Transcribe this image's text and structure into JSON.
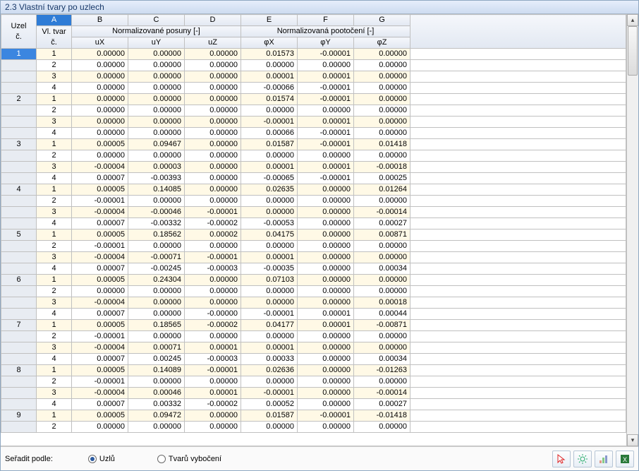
{
  "title": "2.3 Vlastní tvary po uzlech",
  "letters": [
    "A",
    "B",
    "C",
    "D",
    "E",
    "F",
    "G"
  ],
  "group1": {
    "a": "Vl. tvar",
    "posuny": "Normalizované posuny [-]",
    "poot": "Normalizovaná pootočení [-]"
  },
  "uzel_head": {
    "l1": "Uzel",
    "l2": "č."
  },
  "subs": {
    "a": "č.",
    "b": "uX",
    "c": "uY",
    "d": "uZ",
    "e": "φX",
    "f": "φY",
    "g": "φZ"
  },
  "sort": {
    "label": "Seřadit podle:",
    "opt1": "Uzlů",
    "opt2": "Tvarů vybočení"
  },
  "rows": [
    {
      "uzel": "1",
      "vt": "1",
      "ux": "0.00000",
      "uy": "0.00000",
      "uz": "0.00000",
      "px": "0.01573",
      "py": "-0.00001",
      "pz": "0.00000",
      "sh": true,
      "first": true
    },
    {
      "uzel": "",
      "vt": "2",
      "ux": "0.00000",
      "uy": "0.00000",
      "uz": "0.00000",
      "px": "0.00000",
      "py": "0.00000",
      "pz": "0.00000"
    },
    {
      "uzel": "",
      "vt": "3",
      "ux": "0.00000",
      "uy": "0.00000",
      "uz": "0.00000",
      "px": "0.00001",
      "py": "0.00001",
      "pz": "0.00000",
      "sh": true
    },
    {
      "uzel": "",
      "vt": "4",
      "ux": "0.00000",
      "uy": "0.00000",
      "uz": "0.00000",
      "px": "-0.00066",
      "py": "-0.00001",
      "pz": "0.00000"
    },
    {
      "uzel": "2",
      "vt": "1",
      "ux": "0.00000",
      "uy": "0.00000",
      "uz": "0.00000",
      "px": "0.01574",
      "py": "-0.00001",
      "pz": "0.00000",
      "sh": true
    },
    {
      "uzel": "",
      "vt": "2",
      "ux": "0.00000",
      "uy": "0.00000",
      "uz": "0.00000",
      "px": "0.00000",
      "py": "0.00000",
      "pz": "0.00000"
    },
    {
      "uzel": "",
      "vt": "3",
      "ux": "0.00000",
      "uy": "0.00000",
      "uz": "0.00000",
      "px": "-0.00001",
      "py": "0.00001",
      "pz": "0.00000",
      "sh": true
    },
    {
      "uzel": "",
      "vt": "4",
      "ux": "0.00000",
      "uy": "0.00000",
      "uz": "0.00000",
      "px": "0.00066",
      "py": "-0.00001",
      "pz": "0.00000"
    },
    {
      "uzel": "3",
      "vt": "1",
      "ux": "0.00005",
      "uy": "0.09467",
      "uz": "0.00000",
      "px": "0.01587",
      "py": "-0.00001",
      "pz": "0.01418",
      "sh": true
    },
    {
      "uzel": "",
      "vt": "2",
      "ux": "0.00000",
      "uy": "0.00000",
      "uz": "0.00000",
      "px": "0.00000",
      "py": "0.00000",
      "pz": "0.00000"
    },
    {
      "uzel": "",
      "vt": "3",
      "ux": "-0.00004",
      "uy": "0.00003",
      "uz": "0.00000",
      "px": "0.00001",
      "py": "0.00001",
      "pz": "-0.00018",
      "sh": true
    },
    {
      "uzel": "",
      "vt": "4",
      "ux": "0.00007",
      "uy": "-0.00393",
      "uz": "0.00000",
      "px": "-0.00065",
      "py": "-0.00001",
      "pz": "0.00025"
    },
    {
      "uzel": "4",
      "vt": "1",
      "ux": "0.00005",
      "uy": "0.14085",
      "uz": "0.00000",
      "px": "0.02635",
      "py": "0.00000",
      "pz": "0.01264",
      "sh": true
    },
    {
      "uzel": "",
      "vt": "2",
      "ux": "-0.00001",
      "uy": "0.00000",
      "uz": "0.00000",
      "px": "0.00000",
      "py": "0.00000",
      "pz": "0.00000"
    },
    {
      "uzel": "",
      "vt": "3",
      "ux": "-0.00004",
      "uy": "-0.00046",
      "uz": "-0.00001",
      "px": "0.00000",
      "py": "0.00000",
      "pz": "-0.00014",
      "sh": true
    },
    {
      "uzel": "",
      "vt": "4",
      "ux": "0.00007",
      "uy": "-0.00332",
      "uz": "-0.00002",
      "px": "-0.00053",
      "py": "0.00000",
      "pz": "0.00027"
    },
    {
      "uzel": "5",
      "vt": "1",
      "ux": "0.00005",
      "uy": "0.18562",
      "uz": "0.00002",
      "px": "0.04175",
      "py": "0.00000",
      "pz": "0.00871",
      "sh": true
    },
    {
      "uzel": "",
      "vt": "2",
      "ux": "-0.00001",
      "uy": "0.00000",
      "uz": "0.00000",
      "px": "0.00000",
      "py": "0.00000",
      "pz": "0.00000"
    },
    {
      "uzel": "",
      "vt": "3",
      "ux": "-0.00004",
      "uy": "-0.00071",
      "uz": "-0.00001",
      "px": "0.00001",
      "py": "0.00000",
      "pz": "0.00000",
      "sh": true
    },
    {
      "uzel": "",
      "vt": "4",
      "ux": "0.00007",
      "uy": "-0.00245",
      "uz": "-0.00003",
      "px": "-0.00035",
      "py": "0.00000",
      "pz": "0.00034"
    },
    {
      "uzel": "6",
      "vt": "1",
      "ux": "0.00005",
      "uy": "0.24304",
      "uz": "0.00000",
      "px": "0.07103",
      "py": "0.00000",
      "pz": "0.00000",
      "sh": true
    },
    {
      "uzel": "",
      "vt": "2",
      "ux": "0.00000",
      "uy": "0.00000",
      "uz": "0.00000",
      "px": "0.00000",
      "py": "0.00000",
      "pz": "0.00000"
    },
    {
      "uzel": "",
      "vt": "3",
      "ux": "-0.00004",
      "uy": "0.00000",
      "uz": "0.00000",
      "px": "0.00000",
      "py": "0.00000",
      "pz": "0.00018",
      "sh": true
    },
    {
      "uzel": "",
      "vt": "4",
      "ux": "0.00007",
      "uy": "0.00000",
      "uz": "-0.00000",
      "px": "-0.00001",
      "py": "0.00001",
      "pz": "0.00044"
    },
    {
      "uzel": "7",
      "vt": "1",
      "ux": "0.00005",
      "uy": "0.18565",
      "uz": "-0.00002",
      "px": "0.04177",
      "py": "0.00001",
      "pz": "-0.00871",
      "sh": true
    },
    {
      "uzel": "",
      "vt": "2",
      "ux": "-0.00001",
      "uy": "0.00000",
      "uz": "0.00000",
      "px": "0.00000",
      "py": "0.00000",
      "pz": "0.00000"
    },
    {
      "uzel": "",
      "vt": "3",
      "ux": "-0.00004",
      "uy": "0.00071",
      "uz": "0.00001",
      "px": "0.00001",
      "py": "0.00000",
      "pz": "0.00000",
      "sh": true
    },
    {
      "uzel": "",
      "vt": "4",
      "ux": "0.00007",
      "uy": "0.00245",
      "uz": "-0.00003",
      "px": "0.00033",
      "py": "0.00000",
      "pz": "0.00034"
    },
    {
      "uzel": "8",
      "vt": "1",
      "ux": "0.00005",
      "uy": "0.14089",
      "uz": "-0.00001",
      "px": "0.02636",
      "py": "0.00000",
      "pz": "-0.01263",
      "sh": true
    },
    {
      "uzel": "",
      "vt": "2",
      "ux": "-0.00001",
      "uy": "0.00000",
      "uz": "0.00000",
      "px": "0.00000",
      "py": "0.00000",
      "pz": "0.00000"
    },
    {
      "uzel": "",
      "vt": "3",
      "ux": "-0.00004",
      "uy": "0.00046",
      "uz": "0.00001",
      "px": "-0.00001",
      "py": "0.00000",
      "pz": "-0.00014",
      "sh": true
    },
    {
      "uzel": "",
      "vt": "4",
      "ux": "0.00007",
      "uy": "0.00332",
      "uz": "-0.00002",
      "px": "0.00052",
      "py": "0.00000",
      "pz": "0.00027"
    },
    {
      "uzel": "9",
      "vt": "1",
      "ux": "0.00005",
      "uy": "0.09472",
      "uz": "0.00000",
      "px": "0.01587",
      "py": "-0.00001",
      "pz": "-0.01418",
      "sh": true
    },
    {
      "uzel": "",
      "vt": "2",
      "ux": "0.00000",
      "uy": "0.00000",
      "uz": "0.00000",
      "px": "0.00000",
      "py": "0.00000",
      "pz": "0.00000"
    }
  ]
}
